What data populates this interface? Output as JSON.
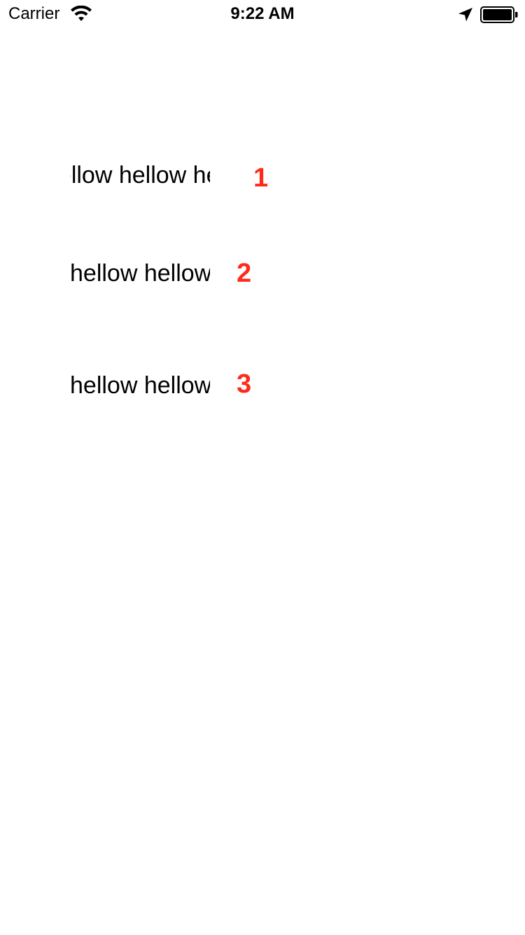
{
  "status_bar": {
    "carrier": "Carrier",
    "time": "9:22 AM",
    "icons": [
      "wifi-icon",
      "location-arrow-icon",
      "battery-icon"
    ]
  },
  "rows": [
    {
      "text": "hellow hellow hellow hellow",
      "number": "1"
    },
    {
      "text": "hellow hellow hellow hellow",
      "number": "2"
    },
    {
      "text": "hellow hellow hellow hellow",
      "number": "3"
    }
  ],
  "colors": {
    "number_label": "#ff2a1a",
    "text": "#000000",
    "background": "#ffffff"
  }
}
